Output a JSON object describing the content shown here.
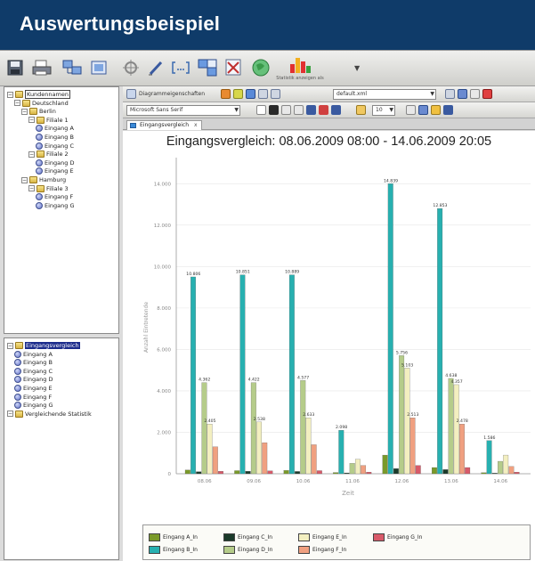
{
  "banner": {
    "title": "Auswertungsbeispiel"
  },
  "toolbar": {
    "buttons": [
      "save-icon",
      "print-icon",
      "network-icon",
      "export-icon",
      "settings-icon",
      "pencil-icon",
      "bracket-icon",
      "compare-icon",
      "report-icon",
      "globe-icon"
    ],
    "chart_button_label": "Statistik anzeigen als",
    "chart_button_icon": "bar-chart-icon"
  },
  "tree": {
    "items": [
      {
        "label": "Kundennamen",
        "level": 0,
        "type": "folder",
        "boxed": true
      },
      {
        "label": "Deutschland",
        "level": 1,
        "type": "folder"
      },
      {
        "label": "Berlin",
        "level": 2,
        "type": "folder"
      },
      {
        "label": "Filiale 1",
        "level": 3,
        "type": "folder"
      },
      {
        "label": "Eingang A",
        "level": 4,
        "type": "net"
      },
      {
        "label": "Eingang B",
        "level": 4,
        "type": "net"
      },
      {
        "label": "Eingang C",
        "level": 4,
        "type": "net"
      },
      {
        "label": "Filiale 2",
        "level": 3,
        "type": "folder"
      },
      {
        "label": "Eingang D",
        "level": 4,
        "type": "net"
      },
      {
        "label": "Eingang E",
        "level": 4,
        "type": "net"
      },
      {
        "label": "Hamburg",
        "level": 2,
        "type": "folder"
      },
      {
        "label": "Filiale 3",
        "level": 3,
        "type": "folder"
      },
      {
        "label": "Eingang F",
        "level": 4,
        "type": "net"
      },
      {
        "label": "Eingang G",
        "level": 4,
        "type": "net"
      }
    ]
  },
  "compare_tree": {
    "items": [
      {
        "label": "Eingangsvergleich",
        "level": 0,
        "type": "folder",
        "selected": true
      },
      {
        "label": "Eingang A",
        "level": 1,
        "type": "net"
      },
      {
        "label": "Eingang B",
        "level": 1,
        "type": "net"
      },
      {
        "label": "Eingang C",
        "level": 1,
        "type": "net"
      },
      {
        "label": "Eingang D",
        "level": 1,
        "type": "net"
      },
      {
        "label": "Eingang E",
        "level": 1,
        "type": "net"
      },
      {
        "label": "Eingang F",
        "level": 1,
        "type": "net"
      },
      {
        "label": "Eingang G",
        "level": 1,
        "type": "net"
      },
      {
        "label": "Vergleichende Statistik",
        "level": 0,
        "type": "folder"
      }
    ]
  },
  "chart_toolbar": {
    "layout_button": "Diagrammeigenschaften",
    "template_combo": "default.xml",
    "font_combo": "Microsoft Sans Serif",
    "size_combo": "10"
  },
  "tab": {
    "label": "Eingangsvergleich",
    "close": "x"
  },
  "chart_data": {
    "type": "bar",
    "title": "Eingangsvergleich: 08.06.2009 08:00 - 14.06.2009 20:05",
    "xlabel": "Zeit",
    "ylabel": "Anzahl Eintretende",
    "ylim": [
      0,
      15000
    ],
    "yticks": [
      "0",
      "2.000",
      "4.000",
      "6.000",
      "8.000",
      "10.000",
      "12.000",
      "14.000"
    ],
    "categories": [
      "08.06",
      "09.06",
      "10.06",
      "11.06",
      "12.06",
      "13.06",
      "14.06"
    ],
    "series": [
      {
        "name": "Eingang A_In",
        "color": "#7a9a2a",
        "values": [
          180,
          150,
          160,
          60,
          900,
          300,
          50
        ]
      },
      {
        "name": "Eingang B_In",
        "color": "#27b0b0",
        "values": [
          9500,
          9600,
          9600,
          2100,
          14000,
          12800,
          1600
        ]
      },
      {
        "name": "Eingang C_In",
        "color": "#1a3a2a",
        "values": [
          100,
          120,
          110,
          40,
          250,
          200,
          30
        ]
      },
      {
        "name": "Eingang D_In",
        "color": "#b5cc8a",
        "values": [
          4400,
          4400,
          4500,
          500,
          5700,
          4600,
          600
        ]
      },
      {
        "name": "Eingang E_In",
        "color": "#f3efc0",
        "values": [
          2400,
          2500,
          2700,
          700,
          5100,
          4300,
          900
        ]
      },
      {
        "name": "Eingang F_In",
        "color": "#f0a080",
        "values": [
          1300,
          1500,
          1400,
          400,
          2700,
          2400,
          350
        ]
      },
      {
        "name": "Eingang G_In",
        "color": "#d85a6a",
        "values": [
          120,
          140,
          150,
          80,
          400,
          300,
          80
        ]
      }
    ],
    "labels": [
      [
        "",
        "10.806",
        "",
        "4.362",
        "2.405",
        "",
        ""
      ],
      [
        "",
        "10.851",
        "",
        "4.422",
        "2.538",
        "",
        ""
      ],
      [
        "",
        "10.889",
        "",
        "4.577",
        "2.633",
        "",
        ""
      ],
      [
        "",
        "2.098",
        "",
        "",
        "",
        "",
        ""
      ],
      [
        "",
        "14.839",
        "",
        "5.756",
        "5.103",
        "2.513",
        ""
      ],
      [
        "",
        "12.853",
        "",
        "4.638",
        "4.357",
        "2.478",
        ""
      ],
      [
        "",
        "1.586",
        "",
        "",
        "",
        "",
        ""
      ]
    ],
    "legend": "bottom"
  }
}
